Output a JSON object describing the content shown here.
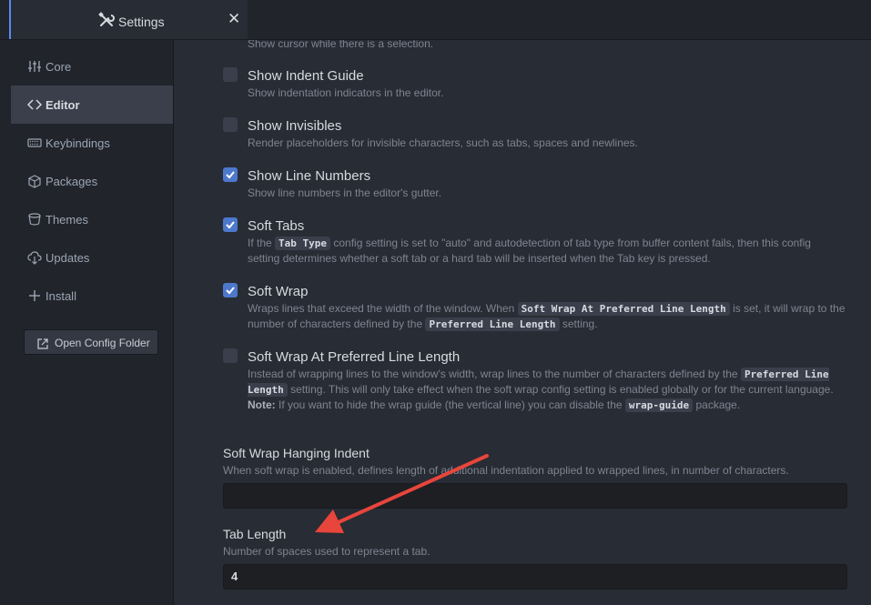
{
  "tab": {
    "title": "Settings",
    "close": "✕"
  },
  "sidebar": {
    "items": [
      {
        "label": "Core",
        "icon": "sliders-icon"
      },
      {
        "label": "Editor",
        "icon": "code-icon",
        "active": true
      },
      {
        "label": "Keybindings",
        "icon": "keyboard-icon"
      },
      {
        "label": "Packages",
        "icon": "package-icon"
      },
      {
        "label": "Themes",
        "icon": "paintcan-icon"
      },
      {
        "label": "Updates",
        "icon": "cloud-download-icon"
      },
      {
        "label": "Install",
        "icon": "plus-icon"
      }
    ],
    "open_config_label": "Open Config Folder"
  },
  "settings": {
    "top_desc": "Show cursor while there is a selection.",
    "indent_guide": {
      "title": "Show Indent Guide",
      "desc": "Show indentation indicators in the editor.",
      "checked": false
    },
    "invisibles": {
      "title": "Show Invisibles",
      "desc": "Render placeholders for invisible characters, such as tabs, spaces and newlines.",
      "checked": false
    },
    "line_numbers": {
      "title": "Show Line Numbers",
      "desc": "Show line numbers in the editor's gutter.",
      "checked": true
    },
    "soft_tabs": {
      "title": "Soft Tabs",
      "checked": true,
      "desc_a": "If the ",
      "code_a": "Tab Type",
      "desc_b": " config setting is set to \"auto\" and autodetection of tab type from buffer content fails, then this config setting determines whether a soft tab or a hard tab will be inserted when the Tab key is pressed."
    },
    "soft_wrap": {
      "title": "Soft Wrap",
      "checked": true,
      "desc_a": "Wraps lines that exceed the width of the window. When ",
      "code_a": "Soft Wrap At Preferred Line Length",
      "desc_b": " is set, it will wrap to the number of characters defined by the ",
      "code_b": "Preferred Line Length",
      "desc_c": " setting."
    },
    "soft_wrap_preferred": {
      "title": "Soft Wrap At Preferred Line Length",
      "checked": false,
      "desc_a": "Instead of wrapping lines to the window's width, wrap lines to the number of characters defined by the ",
      "code_a": "Preferred Line Length",
      "desc_b": " setting. This will only take effect when the soft wrap config setting is enabled globally or for the current language. ",
      "note": "Note:",
      "desc_c": " If you want to hide the wrap guide (the vertical line) you can disable the ",
      "code_b": "wrap-guide",
      "desc_d": " package."
    },
    "hanging_indent": {
      "title": "Soft Wrap Hanging Indent",
      "desc": "When soft wrap is enabled, defines length of additional indentation applied to wrapped lines, in number of characters.",
      "value": ""
    },
    "tab_length": {
      "title": "Tab Length",
      "desc": "Number of spaces used to represent a tab.",
      "value": "4"
    }
  },
  "colors": {
    "accent": "#568af2",
    "checkbox_checked": "#4d78cc",
    "annotation_arrow": "#e8453c"
  }
}
